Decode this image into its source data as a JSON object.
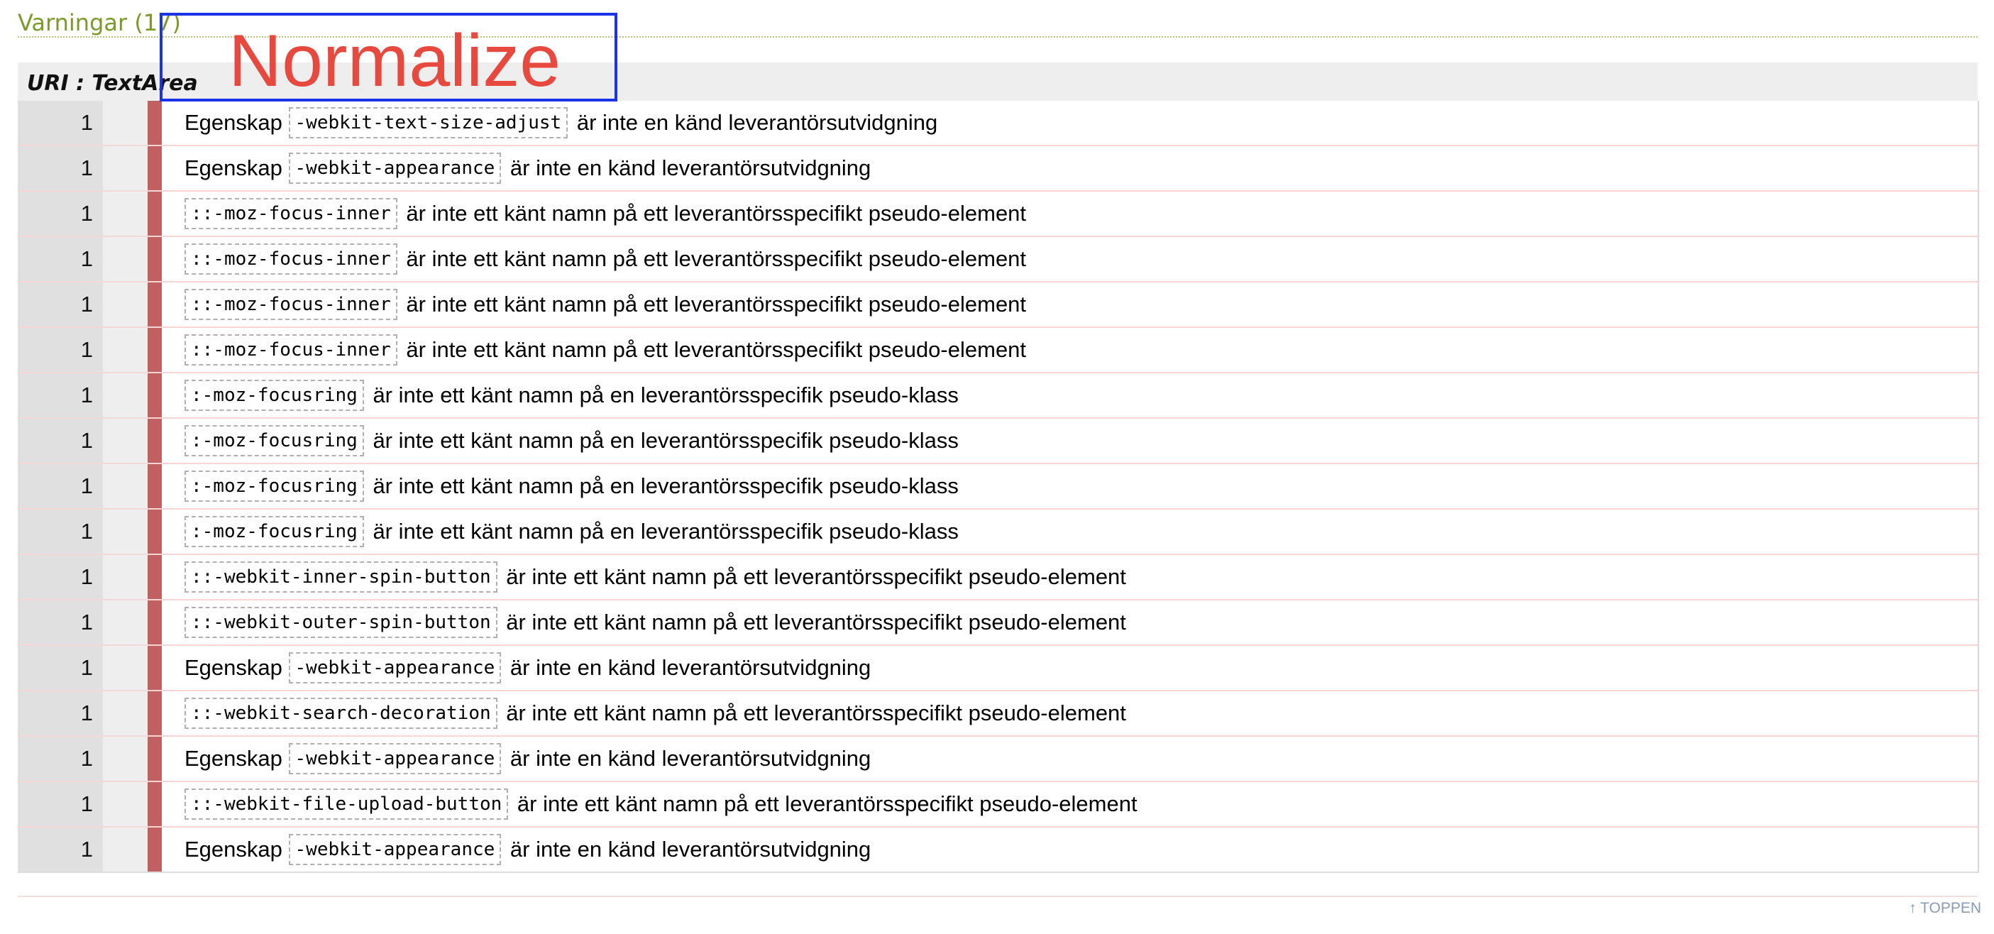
{
  "section": {
    "heading": "Varningar (17)",
    "uri": "URI : TextArea"
  },
  "warnings": [
    {
      "count": "1",
      "prefix": "Egenskap",
      "code": "-webkit-text-size-adjust",
      "message": "är inte en känd leverantörsutvidgning"
    },
    {
      "count": "1",
      "prefix": "Egenskap",
      "code": "-webkit-appearance",
      "message": "är inte en känd leverantörsutvidgning"
    },
    {
      "count": "1",
      "prefix": "",
      "code": "::-moz-focus-inner",
      "message": "är inte ett känt namn på ett leverantörsspecifikt pseudo-element"
    },
    {
      "count": "1",
      "prefix": "",
      "code": "::-moz-focus-inner",
      "message": "är inte ett känt namn på ett leverantörsspecifikt pseudo-element"
    },
    {
      "count": "1",
      "prefix": "",
      "code": "::-moz-focus-inner",
      "message": "är inte ett känt namn på ett leverantörsspecifikt pseudo-element"
    },
    {
      "count": "1",
      "prefix": "",
      "code": "::-moz-focus-inner",
      "message": "är inte ett känt namn på ett leverantörsspecifikt pseudo-element"
    },
    {
      "count": "1",
      "prefix": "",
      "code": ":-moz-focusring",
      "message": "är inte ett känt namn på en leverantörsspecifik pseudo-klass"
    },
    {
      "count": "1",
      "prefix": "",
      "code": ":-moz-focusring",
      "message": "är inte ett känt namn på en leverantörsspecifik pseudo-klass"
    },
    {
      "count": "1",
      "prefix": "",
      "code": ":-moz-focusring",
      "message": "är inte ett känt namn på en leverantörsspecifik pseudo-klass"
    },
    {
      "count": "1",
      "prefix": "",
      "code": ":-moz-focusring",
      "message": "är inte ett känt namn på en leverantörsspecifik pseudo-klass"
    },
    {
      "count": "1",
      "prefix": "",
      "code": "::-webkit-inner-spin-button",
      "message": "är inte ett känt namn på ett leverantörsspecifikt pseudo-element"
    },
    {
      "count": "1",
      "prefix": "",
      "code": "::-webkit-outer-spin-button",
      "message": "är inte ett känt namn på ett leverantörsspecifikt pseudo-element"
    },
    {
      "count": "1",
      "prefix": "Egenskap",
      "code": "-webkit-appearance",
      "message": "är inte en känd leverantörsutvidgning"
    },
    {
      "count": "1",
      "prefix": "",
      "code": "::-webkit-search-decoration",
      "message": "är inte ett känt namn på ett leverantörsspecifikt pseudo-element"
    },
    {
      "count": "1",
      "prefix": "Egenskap",
      "code": "-webkit-appearance",
      "message": "är inte en känd leverantörsutvidgning"
    },
    {
      "count": "1",
      "prefix": "",
      "code": "::-webkit-file-upload-button",
      "message": "är inte ett känt namn på ett leverantörsspecifikt pseudo-element"
    },
    {
      "count": "1",
      "prefix": "Egenskap",
      "code": "-webkit-appearance",
      "message": "är inte en känd leverantörsutvidgning"
    }
  ],
  "footer": {
    "arrow": "↑",
    "top_link": "TOPPEN"
  },
  "overlay": {
    "label": "Normalize",
    "text_color": "#e8493f",
    "box_color": "#1a33e6"
  },
  "colors": {
    "heading": "#7a9a2a",
    "severity_marker": "#c06060"
  }
}
